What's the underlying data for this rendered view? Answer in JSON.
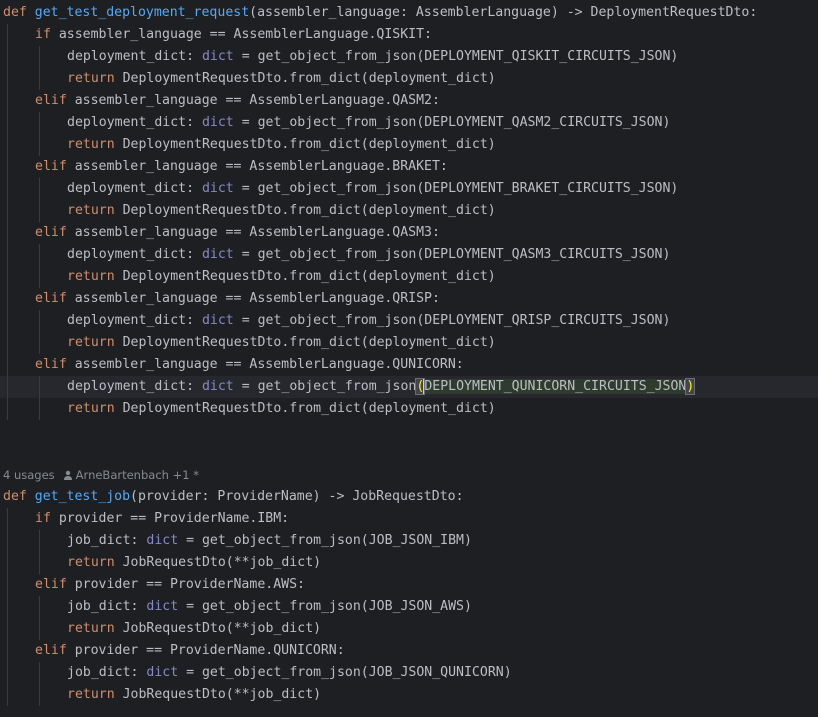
{
  "lines": [
    {
      "indent": 0,
      "tokens": [
        {
          "t": "def ",
          "c": "kw"
        },
        {
          "t": "get_test_deployment_request",
          "c": "fn"
        },
        {
          "t": "(assembler_language: AssemblerLanguage) -> DeploymentRequestDto:",
          "c": "plain"
        }
      ]
    },
    {
      "indent": 1,
      "tokens": [
        {
          "t": "if ",
          "c": "kw"
        },
        {
          "t": "assembler_language == AssemblerLanguage.QISKIT:",
          "c": "plain"
        }
      ]
    },
    {
      "indent": 2,
      "tokens": [
        {
          "t": "deployment_dict: ",
          "c": "plain"
        },
        {
          "t": "dict",
          "c": "builtin"
        },
        {
          "t": " = get_object_from_json(DEPLOYMENT_QISKIT_CIRCUITS_JSON)",
          "c": "plain"
        }
      ]
    },
    {
      "indent": 2,
      "tokens": [
        {
          "t": "return ",
          "c": "kw"
        },
        {
          "t": "DeploymentRequestDto.from_dict(deployment_dict)",
          "c": "plain"
        }
      ]
    },
    {
      "indent": 1,
      "tokens": [
        {
          "t": "elif ",
          "c": "kw"
        },
        {
          "t": "assembler_language == AssemblerLanguage.QASM2:",
          "c": "plain"
        }
      ]
    },
    {
      "indent": 2,
      "tokens": [
        {
          "t": "deployment_dict: ",
          "c": "plain"
        },
        {
          "t": "dict",
          "c": "builtin"
        },
        {
          "t": " = get_object_from_json(DEPLOYMENT_QASM2_CIRCUITS_JSON)",
          "c": "plain"
        }
      ]
    },
    {
      "indent": 2,
      "tokens": [
        {
          "t": "return ",
          "c": "kw"
        },
        {
          "t": "DeploymentRequestDto.from_dict(deployment_dict)",
          "c": "plain"
        }
      ]
    },
    {
      "indent": 1,
      "tokens": [
        {
          "t": "elif ",
          "c": "kw"
        },
        {
          "t": "assembler_language == AssemblerLanguage.BRAKET:",
          "c": "plain"
        }
      ]
    },
    {
      "indent": 2,
      "tokens": [
        {
          "t": "deployment_dict: ",
          "c": "plain"
        },
        {
          "t": "dict",
          "c": "builtin"
        },
        {
          "t": " = get_object_from_json(DEPLOYMENT_BRAKET_CIRCUITS_JSON)",
          "c": "plain"
        }
      ]
    },
    {
      "indent": 2,
      "tokens": [
        {
          "t": "return ",
          "c": "kw"
        },
        {
          "t": "DeploymentRequestDto.from_dict(deployment_dict)",
          "c": "plain"
        }
      ]
    },
    {
      "indent": 1,
      "tokens": [
        {
          "t": "elif ",
          "c": "kw"
        },
        {
          "t": "assembler_language == AssemblerLanguage.QASM3:",
          "c": "plain"
        }
      ]
    },
    {
      "indent": 2,
      "tokens": [
        {
          "t": "deployment_dict: ",
          "c": "plain"
        },
        {
          "t": "dict",
          "c": "builtin"
        },
        {
          "t": " = get_object_from_json(DEPLOYMENT_QASM3_CIRCUITS_JSON)",
          "c": "plain"
        }
      ]
    },
    {
      "indent": 2,
      "tokens": [
        {
          "t": "return ",
          "c": "kw"
        },
        {
          "t": "DeploymentRequestDto.from_dict(deployment_dict)",
          "c": "plain"
        }
      ]
    },
    {
      "indent": 1,
      "tokens": [
        {
          "t": "elif ",
          "c": "kw"
        },
        {
          "t": "assembler_language == AssemblerLanguage.QRISP:",
          "c": "plain"
        }
      ]
    },
    {
      "indent": 2,
      "tokens": [
        {
          "t": "deployment_dict: ",
          "c": "plain"
        },
        {
          "t": "dict",
          "c": "builtin"
        },
        {
          "t": " = get_object_from_json(DEPLOYMENT_QRISP_CIRCUITS_JSON)",
          "c": "plain"
        }
      ]
    },
    {
      "indent": 2,
      "tokens": [
        {
          "t": "return ",
          "c": "kw"
        },
        {
          "t": "DeploymentRequestDto.from_dict(deployment_dict)",
          "c": "plain"
        }
      ]
    },
    {
      "indent": 1,
      "tokens": [
        {
          "t": "elif ",
          "c": "kw"
        },
        {
          "t": "assembler_language == AssemblerLanguage.QUNICORN:",
          "c": "plain"
        }
      ]
    },
    {
      "indent": 2,
      "current": true,
      "tokens": [
        {
          "t": "deployment_dict: ",
          "c": "plain"
        },
        {
          "t": "dict",
          "c": "builtin"
        },
        {
          "t": " = get_object_from_json",
          "c": "plain"
        },
        {
          "t": "(",
          "c": "brace-match"
        },
        {
          "caret": true
        },
        {
          "t": "DEPLOYMENT_QUNICORN_CIRCUITS_JSON",
          "c": "hl-ident"
        },
        {
          "t": ")",
          "c": "brace-match"
        }
      ]
    },
    {
      "indent": 2,
      "tokens": [
        {
          "t": "return ",
          "c": "kw"
        },
        {
          "t": "DeploymentRequestDto.from_dict(deployment_dict)",
          "c": "plain"
        }
      ]
    },
    {
      "indent": 0,
      "tokens": []
    },
    {
      "indent": 0,
      "tokens": []
    },
    {
      "inlay": true
    },
    {
      "indent": 0,
      "tokens": [
        {
          "t": "def ",
          "c": "kw"
        },
        {
          "t": "get_test_job",
          "c": "fn"
        },
        {
          "t": "(provider: ProviderName) -> JobRequestDto:",
          "c": "plain"
        }
      ]
    },
    {
      "indent": 1,
      "tokens": [
        {
          "t": "if ",
          "c": "kw"
        },
        {
          "t": "provider == ProviderName.IBM:",
          "c": "plain"
        }
      ]
    },
    {
      "indent": 2,
      "tokens": [
        {
          "t": "job_dict: ",
          "c": "plain"
        },
        {
          "t": "dict",
          "c": "builtin"
        },
        {
          "t": " = get_object_from_json(JOB_JSON_IBM)",
          "c": "plain"
        }
      ]
    },
    {
      "indent": 2,
      "tokens": [
        {
          "t": "return ",
          "c": "kw"
        },
        {
          "t": "JobRequestDto(**job_dict)",
          "c": "plain"
        }
      ]
    },
    {
      "indent": 1,
      "tokens": [
        {
          "t": "elif ",
          "c": "kw"
        },
        {
          "t": "provider == ProviderName.AWS:",
          "c": "plain"
        }
      ]
    },
    {
      "indent": 2,
      "tokens": [
        {
          "t": "job_dict: ",
          "c": "plain"
        },
        {
          "t": "dict",
          "c": "builtin"
        },
        {
          "t": " = get_object_from_json(JOB_JSON_AWS)",
          "c": "plain"
        }
      ]
    },
    {
      "indent": 2,
      "tokens": [
        {
          "t": "return ",
          "c": "kw"
        },
        {
          "t": "JobRequestDto(**job_dict)",
          "c": "plain"
        }
      ]
    },
    {
      "indent": 1,
      "tokens": [
        {
          "t": "elif ",
          "c": "kw"
        },
        {
          "t": "provider == ProviderName.QUNICORN:",
          "c": "plain"
        }
      ]
    },
    {
      "indent": 2,
      "tokens": [
        {
          "t": "job_dict: ",
          "c": "plain"
        },
        {
          "t": "dict",
          "c": "builtin"
        },
        {
          "t": " = get_object_from_json(JOB_JSON_QUNICORN)",
          "c": "plain"
        }
      ]
    },
    {
      "indent": 2,
      "tokens": [
        {
          "t": "return ",
          "c": "kw"
        },
        {
          "t": "JobRequestDto(**job_dict)",
          "c": "plain"
        }
      ]
    }
  ],
  "inlay_hint": {
    "usages": "4 usages",
    "author": "ArneBartenbach +1 *",
    "author_icon": "user-icon"
  },
  "colors": {
    "background": "#1e1f22",
    "keyword": "#cf8e6d",
    "function": "#56a8f5",
    "builtin": "#8888c6",
    "text": "#bcbec4"
  }
}
